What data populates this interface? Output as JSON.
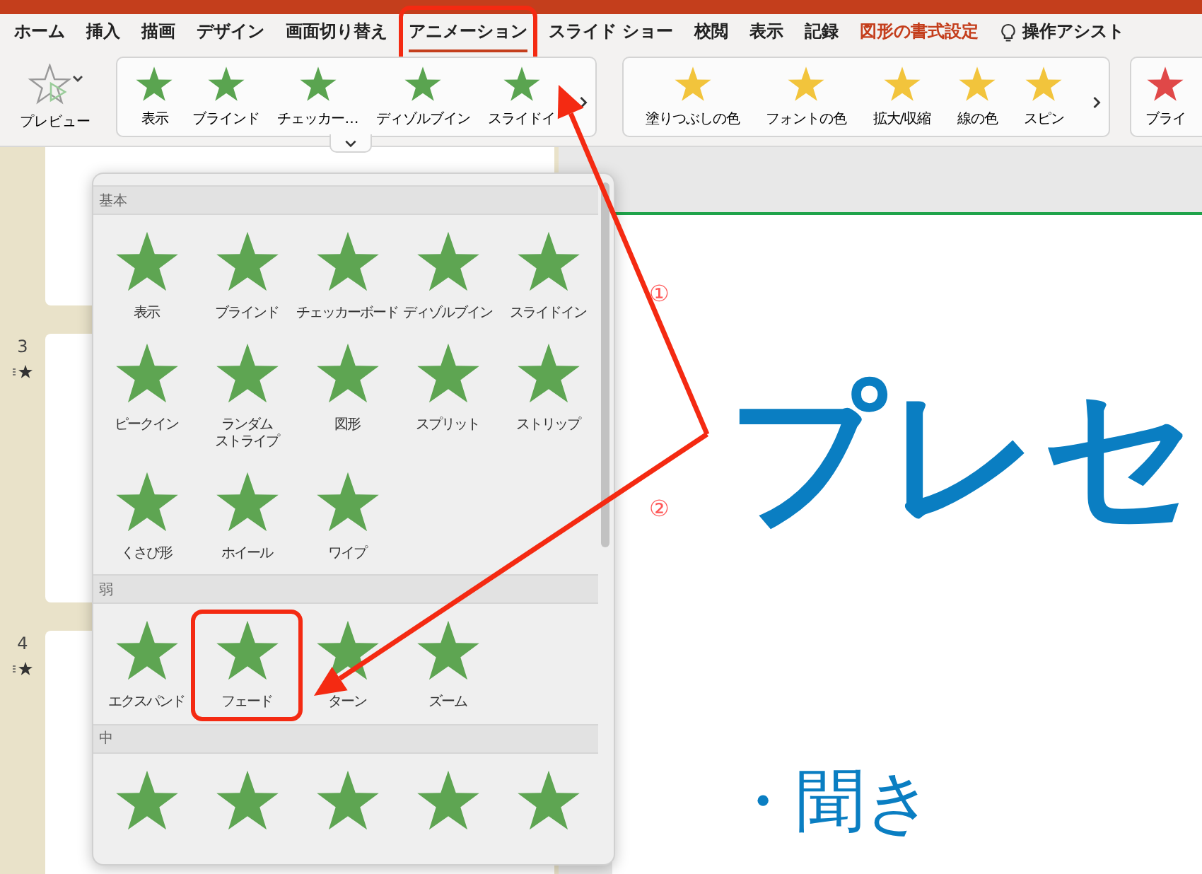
{
  "tabs": [
    {
      "label": "ホーム",
      "kind": "normal",
      "selected": false,
      "highlighted": false
    },
    {
      "label": "挿入",
      "kind": "normal",
      "selected": false,
      "highlighted": false
    },
    {
      "label": "描画",
      "kind": "normal",
      "selected": false,
      "highlighted": false
    },
    {
      "label": "デザイン",
      "kind": "normal",
      "selected": false,
      "highlighted": false
    },
    {
      "label": "画面切り替え",
      "kind": "normal",
      "selected": false,
      "highlighted": false
    },
    {
      "label": "アニメーション",
      "kind": "normal",
      "selected": true,
      "highlighted": true
    },
    {
      "label": "スライド ショー",
      "kind": "normal",
      "selected": false,
      "highlighted": false
    },
    {
      "label": "校閲",
      "kind": "normal",
      "selected": false,
      "highlighted": false
    },
    {
      "label": "表示",
      "kind": "normal",
      "selected": false,
      "highlighted": false
    },
    {
      "label": "記録",
      "kind": "normal",
      "selected": false,
      "highlighted": false
    },
    {
      "label": "図形の書式設定",
      "kind": "contextual",
      "selected": false,
      "highlighted": false
    },
    {
      "label": "操作アシスト",
      "kind": "assist",
      "selected": false,
      "highlighted": false
    }
  ],
  "ribbon": {
    "preview_label": "プレビュー",
    "galleries": [
      {
        "kind": "entrance",
        "items": [
          "表示",
          "ブラインド",
          "チェッカー…",
          "ディゾルブイン",
          "スライドイ"
        ]
      },
      {
        "kind": "emphasis",
        "items": [
          "塗りつぶしの色",
          "フォントの色",
          "拡大/収縮",
          "線の色",
          "スピン"
        ]
      },
      {
        "kind": "exit",
        "items": [
          "ブライ"
        ]
      }
    ]
  },
  "thumbnails": [
    {
      "number": "3"
    },
    {
      "number": "4"
    }
  ],
  "popup": {
    "sections": [
      {
        "title": "基本",
        "items": [
          {
            "kind": "labeled",
            "label": "表示",
            "highlighted": false
          },
          {
            "kind": "labeled",
            "label": "ブラインド",
            "highlighted": false
          },
          {
            "kind": "labeled",
            "label": "チェッカーボード",
            "highlighted": false
          },
          {
            "kind": "labeled",
            "label": "ディゾルブイン",
            "highlighted": false
          },
          {
            "kind": "labeled",
            "label": "スライドイン",
            "highlighted": false
          },
          {
            "kind": "labeled",
            "label": "ピークイン",
            "highlighted": false
          },
          {
            "kind": "labeled",
            "label": "ランダム",
            "label_2": "ストライプ",
            "highlighted": false
          },
          {
            "kind": "labeled",
            "label": "図形",
            "highlighted": false
          },
          {
            "kind": "labeled",
            "label": "スプリット",
            "highlighted": false
          },
          {
            "kind": "labeled",
            "label": "ストリップ",
            "highlighted": false
          },
          {
            "kind": "labeled",
            "label": "くさび形",
            "highlighted": false
          },
          {
            "kind": "labeled",
            "label": "ホイール",
            "highlighted": false
          },
          {
            "kind": "labeled",
            "label": "ワイプ",
            "highlighted": false
          }
        ]
      },
      {
        "title": "弱",
        "items": [
          {
            "kind": "labeled",
            "label": "エクスパンド",
            "highlighted": false
          },
          {
            "kind": "labeled",
            "label": "フェード",
            "highlighted": true
          },
          {
            "kind": "labeled",
            "label": "ターン",
            "highlighted": false
          },
          {
            "kind": "labeled",
            "label": "ズーム",
            "highlighted": false
          }
        ]
      },
      {
        "title": "中",
        "items": [
          {
            "kind": "icon"
          },
          {
            "kind": "icon"
          },
          {
            "kind": "icon"
          },
          {
            "kind": "icon"
          },
          {
            "kind": "icon"
          }
        ]
      }
    ]
  },
  "slide": {
    "title": "プレセ",
    "bullet": "・聞き"
  },
  "annotations": {
    "markers": [
      "①",
      "②"
    ]
  }
}
